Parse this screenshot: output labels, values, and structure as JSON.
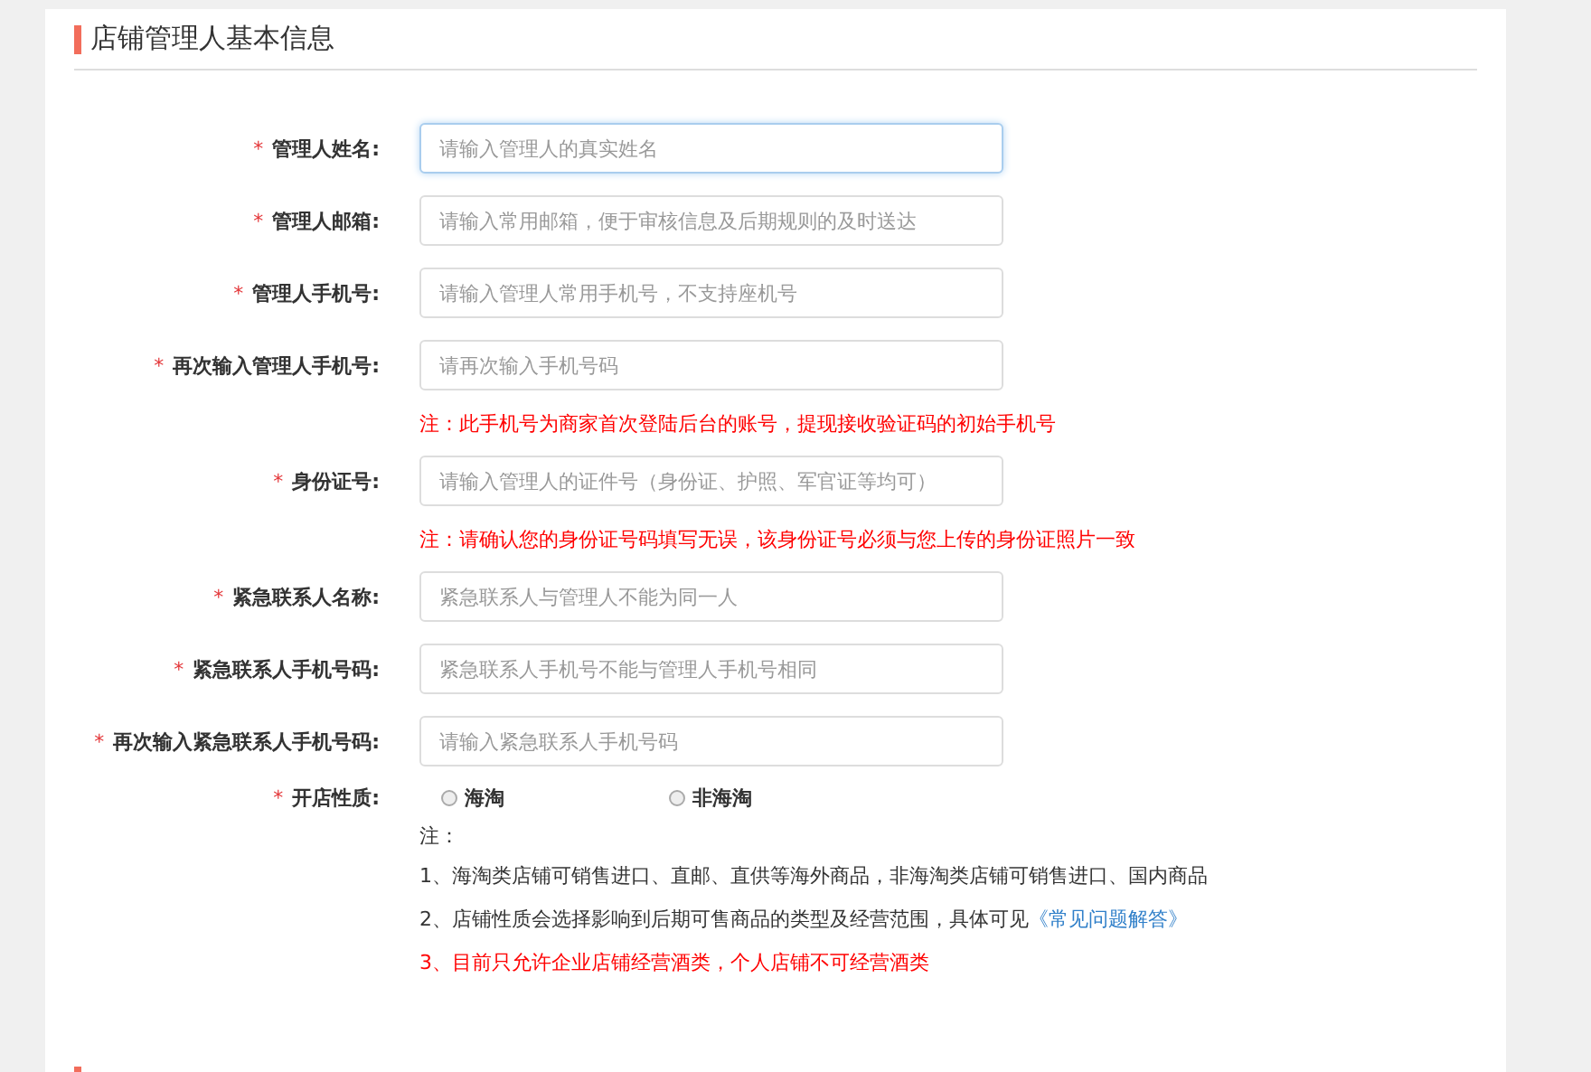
{
  "section_title": "店铺管理人基本信息",
  "rows": [
    {
      "kind": "input",
      "mark": "*",
      "label": "管理人姓名:",
      "placeholder": "请输入管理人的真实姓名",
      "focused": true
    },
    {
      "kind": "input",
      "mark": "*",
      "label": "管理人邮箱:",
      "placeholder": "请输入常用邮箱，便于审核信息及后期规则的及时送达",
      "focused": false
    },
    {
      "kind": "input",
      "mark": "*",
      "label": "管理人手机号:",
      "placeholder": "请输入管理人常用手机号，不支持座机号",
      "focused": false
    },
    {
      "kind": "input",
      "mark": "*",
      "label": "再次输入管理人手机号:",
      "placeholder": "请再次输入手机号码",
      "focused": false
    },
    {
      "kind": "note",
      "text": "注：此手机号为商家首次登陆后台的账号，提现接收验证码的初始手机号"
    },
    {
      "kind": "input",
      "mark": "*",
      "label": "身份证号:",
      "placeholder": "请输入管理人的证件号（身份证、护照、军官证等均可）",
      "focused": false
    },
    {
      "kind": "note",
      "text": "注：请确认您的身份证号码填写无误，该身份证号必须与您上传的身份证照片一致"
    },
    {
      "kind": "input",
      "mark": "*",
      "label": "紧急联系人名称:",
      "placeholder": "紧急联系人与管理人不能为同一人",
      "focused": false
    },
    {
      "kind": "input",
      "mark": "*",
      "label": "紧急联系人手机号码:",
      "placeholder": "紧急联系人手机号不能与管理人手机号相同",
      "focused": false
    },
    {
      "kind": "input",
      "mark": "*",
      "label": "再次输入紧急联系人手机号码:",
      "placeholder": "请输入紧急联系人手机号码",
      "focused": false
    },
    {
      "kind": "radio",
      "mark": "*",
      "label": "开店性质:",
      "options": [
        {
          "label": "海淘",
          "selected": false
        },
        {
          "label": "非海淘",
          "selected": false
        }
      ]
    }
  ],
  "notes_heading": "注：",
  "notes": [
    {
      "kind": "plain",
      "text": "1、海淘类店铺可销售进口、直邮、直供等海外商品，非海淘类店铺可销售进口、国内商品"
    },
    {
      "kind": "plain",
      "text": "2、店铺性质会选择影响到后期可售商品的类型及经营范围，具体可见",
      "link": "《常见问题解答》"
    },
    {
      "kind": "warning",
      "text": "3、目前只允许企业店铺经营酒类，个人店铺不可经营酒类"
    }
  ]
}
